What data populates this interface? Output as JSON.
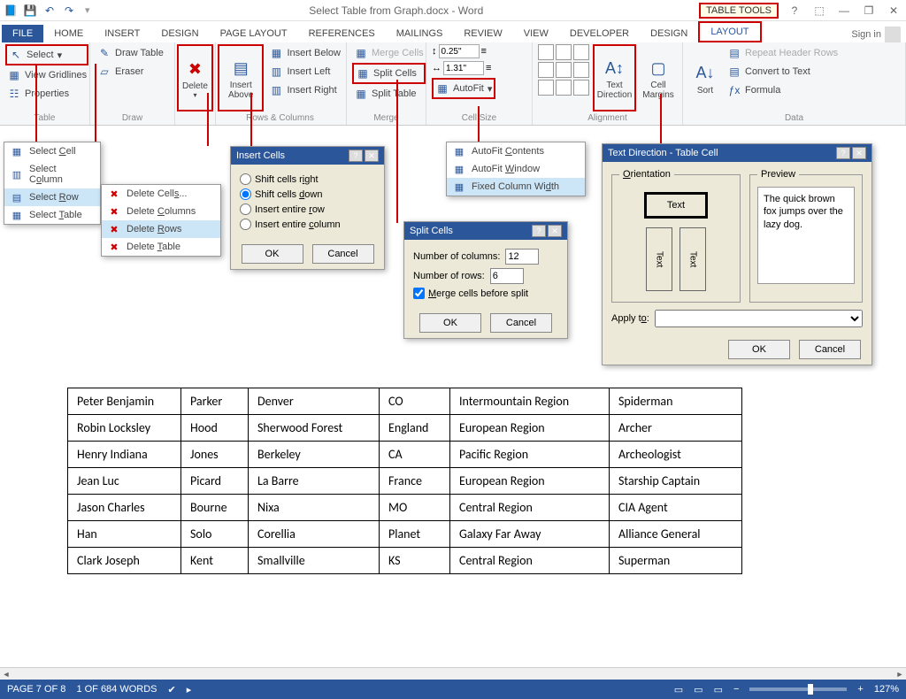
{
  "titlebar": {
    "doc_title": "Select Table from Graph.docx - Word",
    "table_tools": "TABLE TOOLS"
  },
  "tabs": {
    "file": "FILE",
    "home": "HOME",
    "insert": "INSERT",
    "design": "DESIGN",
    "page_layout": "PAGE LAYOUT",
    "references": "REFERENCES",
    "mailings": "MAILINGS",
    "review": "REVIEW",
    "view": "VIEW",
    "developer": "DEVELOPER",
    "tt_design": "DESIGN",
    "tt_layout": "LAYOUT",
    "signin": "Sign in"
  },
  "ribbon": {
    "table": {
      "label": "Table",
      "select": "Select",
      "gridlines": "View Gridlines",
      "properties": "Properties"
    },
    "draw": {
      "label": "Draw",
      "draw_table": "Draw Table",
      "eraser": "Eraser"
    },
    "delete": {
      "label": "Delete"
    },
    "rows_cols": {
      "label": "Rows & Columns",
      "insert_above": "Insert Above",
      "insert_below": "Insert Below",
      "insert_left": "Insert Left",
      "insert_right": "Insert Right"
    },
    "merge": {
      "label": "Merge",
      "merge_cells": "Merge Cells",
      "split_cells": "Split Cells",
      "split_table": "Split Table"
    },
    "cell_size": {
      "label": "Cell Size",
      "height": "0.25\"",
      "width": "1.31\"",
      "autofit": "AutoFit"
    },
    "alignment": {
      "label": "Alignment",
      "text_direction": "Text Direction",
      "cell_margins": "Cell Margins"
    },
    "data": {
      "label": "Data",
      "sort": "Sort",
      "repeat_header": "Repeat Header Rows",
      "convert": "Convert to Text",
      "formula": "Formula"
    }
  },
  "select_menu": {
    "cell": "Select Cell",
    "column": "Select Column",
    "row": "Select Row",
    "table": "Select Table"
  },
  "delete_menu": {
    "cells": "Delete Cells...",
    "columns": "Delete Columns",
    "rows": "Delete Rows",
    "table": "Delete Table"
  },
  "autofit_menu": {
    "contents": "AutoFit Contents",
    "window": "AutoFit Window",
    "fixed": "Fixed Column Width"
  },
  "insert_cells_dlg": {
    "title": "Insert Cells",
    "shift_right": "Shift cells right",
    "shift_down": "Shift cells down",
    "entire_row": "Insert entire row",
    "entire_col": "Insert entire column",
    "ok": "OK",
    "cancel": "Cancel"
  },
  "split_cells_dlg": {
    "title": "Split Cells",
    "num_cols_label": "Number of columns:",
    "num_cols": "12",
    "num_rows_label": "Number of rows:",
    "num_rows": "6",
    "merge_before": "Merge cells before split",
    "ok": "OK",
    "cancel": "Cancel"
  },
  "text_dir_dlg": {
    "title": "Text Direction - Table Cell",
    "orientation": "Orientation",
    "preview": "Preview",
    "text": "Text",
    "preview_text": "The quick brown fox jumps over the lazy dog.",
    "apply_to": "Apply to:",
    "ok": "OK",
    "cancel": "Cancel"
  },
  "doc_table": {
    "rows": [
      [
        "Peter Benjamin",
        "Parker",
        "Denver",
        "CO",
        "Intermountain Region",
        "Spiderman"
      ],
      [
        "Robin Locksley",
        "Hood",
        "Sherwood Forest",
        "England",
        "European Region",
        "Archer"
      ],
      [
        "Henry Indiana",
        "Jones",
        "Berkeley",
        "CA",
        "Pacific Region",
        "Archeologist"
      ],
      [
        "Jean Luc",
        "Picard",
        "La Barre",
        "France",
        "European Region",
        "Starship Captain"
      ],
      [
        "Jason Charles",
        "Bourne",
        "Nixa",
        "MO",
        "Central Region",
        "CIA Agent"
      ],
      [
        "Han",
        "Solo",
        "Corellia",
        "Planet",
        "Galaxy Far Away",
        "Alliance General"
      ],
      [
        "Clark Joseph",
        "Kent",
        "Smallville",
        "KS",
        "Central Region",
        "Superman"
      ]
    ]
  },
  "status": {
    "page": "PAGE 7 OF 8",
    "words": "1 OF 684 WORDS",
    "zoom": "127%"
  }
}
